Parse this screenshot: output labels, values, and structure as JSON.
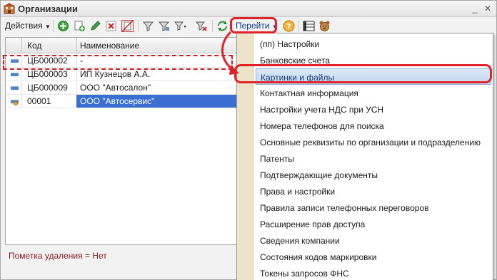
{
  "window": {
    "title": "Организации",
    "minimize_icon": "minimize-icon",
    "close_icon": "close-icon"
  },
  "toolbar": {
    "actions_label": "Действия",
    "goto_label": "Перейти",
    "icons": [
      "add-icon",
      "copy-icon",
      "edit-icon",
      "delete-icon",
      "mark-deletion-icon",
      "filter-icon",
      "filter-settings-icon",
      "filter-list-icon",
      "clear-filter-icon",
      "refresh-icon",
      "help-icon",
      "columns-icon",
      "bear-icon"
    ]
  },
  "grid": {
    "columns": [
      "Код",
      "Наименование"
    ],
    "rows": [
      {
        "code": "ЦБ000002",
        "name": "-",
        "selected": false
      },
      {
        "code": "ЦБ000003",
        "name": "ИП Кузнецов А.А.",
        "selected": false
      },
      {
        "code": "ЦБ000009",
        "name": "ООО \"Автосалон\"",
        "selected": false
      },
      {
        "code": "00001",
        "name": "ООО \"Автосервис\"",
        "selected": true
      }
    ]
  },
  "status": {
    "text": "Пометка удаления = Нет"
  },
  "goto_menu": {
    "items": [
      "(пп) Настройки",
      "Банковские счета",
      "Картинки и файлы",
      "Контактная информация",
      "Настройки учета НДС при УСН",
      "Номера телефонов для поиска",
      "Основные реквизиты по организации и подразделению",
      "Патенты",
      "Подтверждающие документы",
      "Права и настройки",
      "Правила записи телефонных переговоров",
      "Расширение прав доступа",
      "Сведения компании",
      "Состояния кодов маркировки",
      "Токены запросов ФНС"
    ],
    "highlighted": "Картинки и файлы"
  },
  "colors": {
    "selection": "#3a6fd1",
    "highlight_red": "#e0232b",
    "menu_strip": "#ece3c9"
  }
}
